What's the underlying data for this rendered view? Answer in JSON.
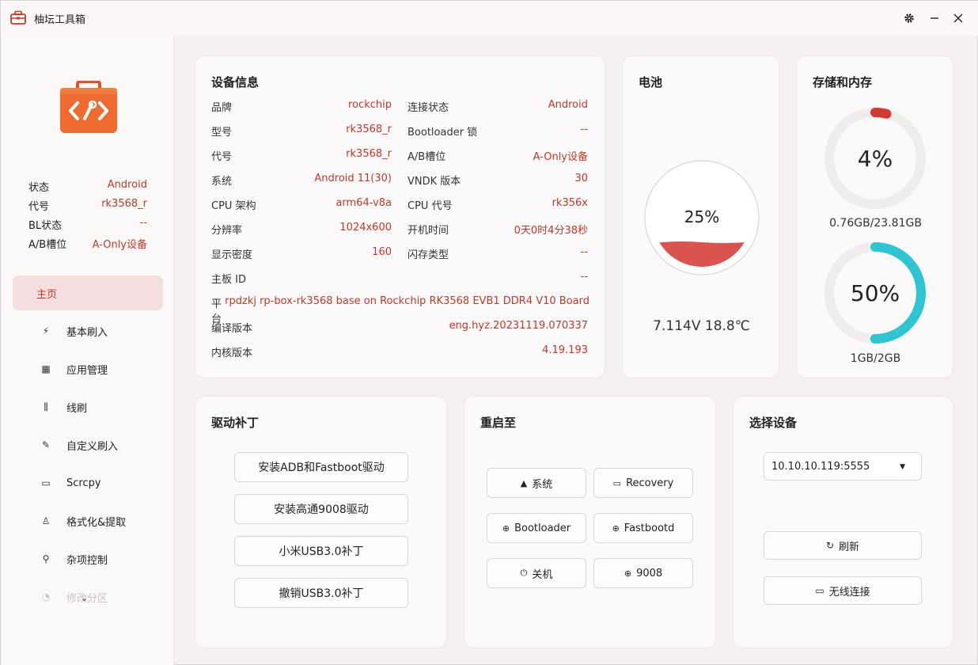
{
  "titlebar": {
    "title": "柚坛工具箱",
    "settings_icon": "gear-icon",
    "minimize_icon": "minimize-icon",
    "close_icon": "close-icon"
  },
  "sidebar": {
    "status": [
      {
        "label": "状态",
        "value": "Android"
      },
      {
        "label": "代号",
        "value": "rk3568_r"
      },
      {
        "label": "BL状态",
        "value": "--"
      },
      {
        "label": "A/B槽位",
        "value": "A-Only设备"
      }
    ],
    "nav": [
      {
        "label": "主页",
        "icon": "home-icon",
        "active": true
      },
      {
        "label": "基本刷入",
        "icon": "flash-icon"
      },
      {
        "label": "应用管理",
        "icon": "apps-icon"
      },
      {
        "label": "线刷",
        "icon": "cable-flash-icon"
      },
      {
        "label": "自定义刷入",
        "icon": "custom-flash-icon"
      },
      {
        "label": "Scrcpy",
        "icon": "screen-mirror-icon"
      },
      {
        "label": "格式化&提取",
        "icon": "format-icon"
      },
      {
        "label": "杂项控制",
        "icon": "misc-control-icon"
      },
      {
        "label": "修改分区",
        "icon": "partition-icon"
      }
    ],
    "bottom_icons": [
      "terminal-icon",
      "github-icon",
      "chat-icon"
    ]
  },
  "device_info": {
    "title": "设备信息",
    "left": [
      {
        "label": "品牌",
        "value": "rockchip"
      },
      {
        "label": "型号",
        "value": "rk3568_r"
      },
      {
        "label": "代号",
        "value": "rk3568_r"
      },
      {
        "label": "系统",
        "value": "Android 11(30)"
      },
      {
        "label": "CPU 架构",
        "value": "arm64-v8a"
      },
      {
        "label": "分辨率",
        "value": "1024x600"
      },
      {
        "label": "显示密度",
        "value": "160"
      }
    ],
    "right": [
      {
        "label": "连接状态",
        "value": "Android"
      },
      {
        "label": "Bootloader 锁",
        "value": "--"
      },
      {
        "label": "A/B槽位",
        "value": "A-Only设备"
      },
      {
        "label": "VNDK 版本",
        "value": "30"
      },
      {
        "label": "CPU 代号",
        "value": "rk356x"
      },
      {
        "label": "开机时间",
        "value": "0天0时4分38秒"
      },
      {
        "label": "闪存类型",
        "value": "--"
      }
    ],
    "board_id": {
      "label": "主板 ID",
      "value": "--"
    },
    "platform": {
      "label": "平台",
      "value": "rpdzkj rp-box-rk3568 base on Rockchip RK3568 EVB1 DDR4 V10 Board"
    },
    "build": {
      "label": "编译版本",
      "value": "eng.hyz.20231119.070337"
    },
    "kernel": {
      "label": "内核版本",
      "value": "4.19.193"
    }
  },
  "battery": {
    "title": "电池",
    "percent_text": "25%",
    "level": 0.25,
    "voltage_temp": "7.114V 18.8℃",
    "color": "#d9534f"
  },
  "storage": {
    "title": "存储和内存",
    "storage_percent_text": "4%",
    "storage_fraction": 0.04,
    "storage_text": "0.76GB/23.81GB",
    "storage_color": "#d13a32",
    "memory_percent_text": "50%",
    "memory_fraction": 0.5,
    "memory_text": "1GB/2GB",
    "memory_color": "#2ec4d1"
  },
  "driver_patch": {
    "title": "驱动补丁",
    "buttons": [
      "安装ADB和Fastboot驱动",
      "安装高通9008驱动",
      "小米USB3.0补丁",
      "撤销USB3.0补丁"
    ]
  },
  "reboot": {
    "title": "重启至",
    "buttons": [
      {
        "label": "系统",
        "icon": "android-icon"
      },
      {
        "label": "Recovery",
        "icon": "monitor-icon"
      },
      {
        "label": "Bootloader",
        "icon": "download-circle-icon"
      },
      {
        "label": "Fastbootd",
        "icon": "download-circle-icon"
      },
      {
        "label": "关机",
        "icon": "power-icon"
      },
      {
        "label": "9008",
        "icon": "download-circle-icon"
      }
    ]
  },
  "select_device": {
    "title": "选择设备",
    "selected": "10.10.10.119:5555",
    "refresh_label": "刷新",
    "wireless_label": "无线连接"
  }
}
